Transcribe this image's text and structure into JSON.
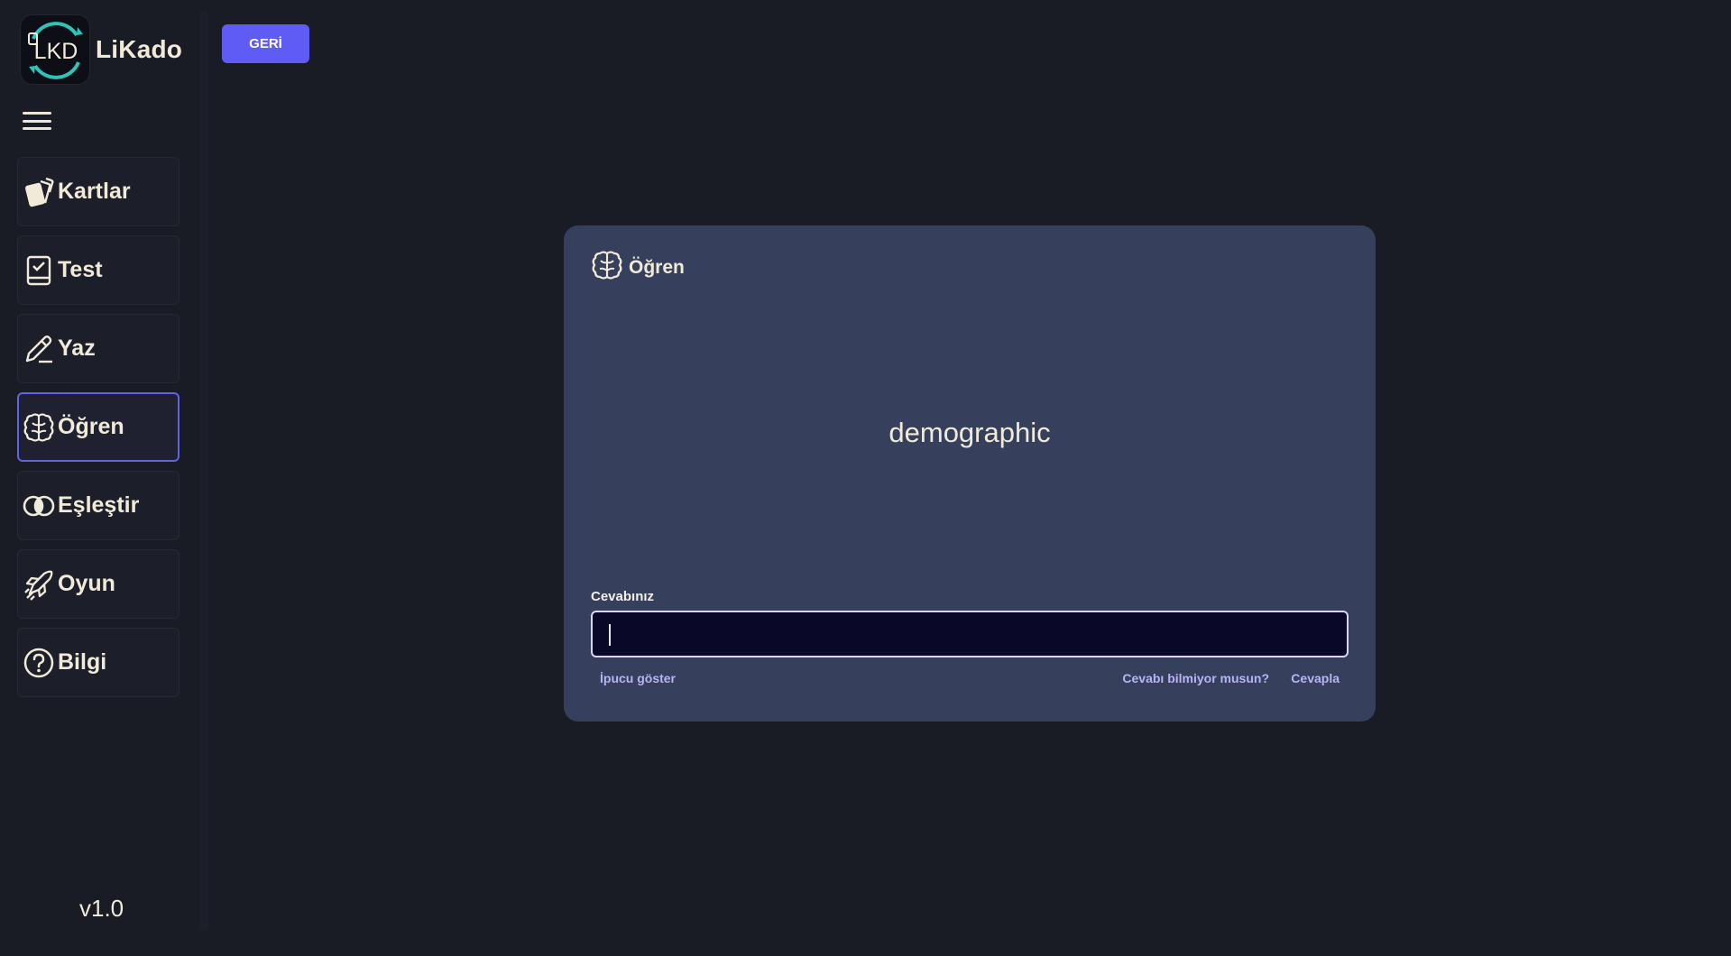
{
  "brand": {
    "name": "LiKado",
    "logo_text": "LKD"
  },
  "nav": {
    "items": [
      {
        "label": "Kartlar",
        "icon": "cards-icon",
        "active": false
      },
      {
        "label": "Test",
        "icon": "checklist-book-icon",
        "active": false
      },
      {
        "label": "Yaz",
        "icon": "pencil-icon",
        "active": false
      },
      {
        "label": "Öğren",
        "icon": "brain-icon",
        "active": true
      },
      {
        "label": "Eşleştir",
        "icon": "overlap-circles-icon",
        "active": false
      },
      {
        "label": "Oyun",
        "icon": "rocket-icon",
        "active": false
      },
      {
        "label": "Bilgi",
        "icon": "help-circle-icon",
        "active": false
      }
    ]
  },
  "version": "v1.0",
  "toolbar": {
    "back_label": "GERİ"
  },
  "card": {
    "title": "Öğren",
    "term": "demographic",
    "answer_label": "Cevabınız",
    "answer_value": "",
    "hint_label": "İpucu göster",
    "unknown_label": "Cevabı bilmiyor musun?",
    "submit_label": "Cevapla"
  },
  "colors": {
    "background": "#191b25",
    "card": "#36405c",
    "accent": "#5f5cf5",
    "text": "#f1ead8",
    "link": "#b8b4f4",
    "input_bg": "#0a0828"
  }
}
